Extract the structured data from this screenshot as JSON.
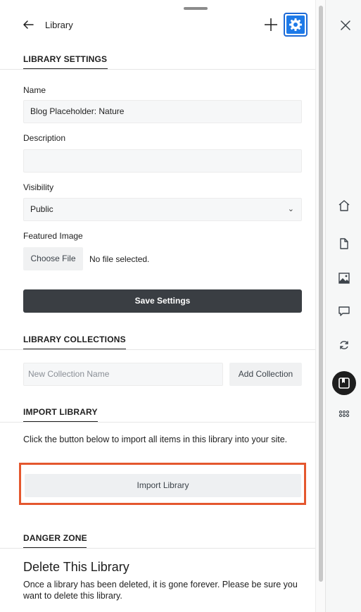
{
  "header": {
    "title": "Library"
  },
  "settings": {
    "section_title": "LIBRARY SETTINGS",
    "name_label": "Name",
    "name_value": "Blog Placeholder: Nature",
    "description_label": "Description",
    "description_value": "",
    "visibility_label": "Visibility",
    "visibility_value": "Public",
    "featured_image_label": "Featured Image",
    "choose_file_label": "Choose File",
    "no_file_text": "No file selected.",
    "save_label": "Save Settings"
  },
  "collections": {
    "section_title": "LIBRARY COLLECTIONS",
    "input_placeholder": "New Collection Name",
    "add_label": "Add Collection"
  },
  "import": {
    "section_title": "IMPORT LIBRARY",
    "description": "Click the button below to import all items in this library into your site.",
    "button_label": "Import Library"
  },
  "danger": {
    "section_title": "DANGER ZONE",
    "heading": "Delete This Library",
    "description": "Once a library has been deleted, it is gone forever. Please be sure you want to delete this library."
  },
  "colors": {
    "accent": "#1e7ae8",
    "highlight": "#e4572e",
    "dark_button": "#3a3e43"
  },
  "icons": {
    "header": [
      "back-arrow-icon",
      "plus-icon",
      "gear-icon"
    ],
    "rail": [
      "close-icon",
      "home-icon",
      "page-icon",
      "image-icon",
      "comment-icon",
      "sync-icon",
      "library-icon",
      "grid-dots-icon"
    ]
  }
}
